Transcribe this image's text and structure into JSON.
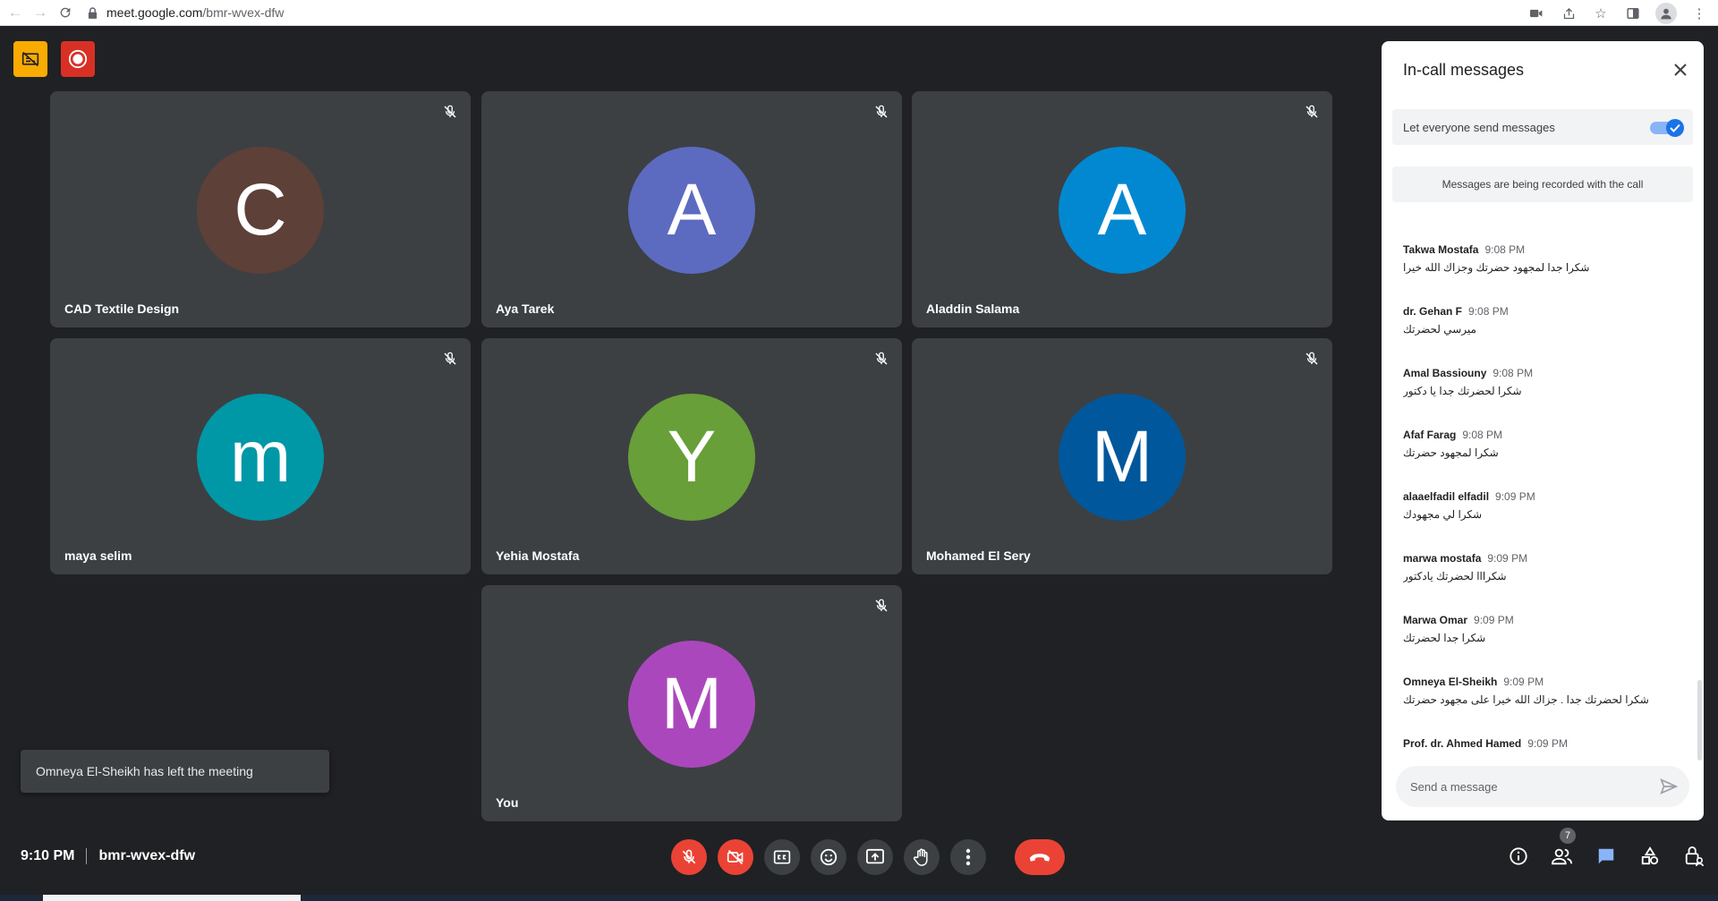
{
  "browser": {
    "url_host": "meet.google.com",
    "url_path": "/bmr-wvex-dfw"
  },
  "tiles": [
    {
      "name": "CAD Textile Design",
      "initial": "C",
      "color": "#5d4037"
    },
    {
      "name": "Aya Tarek",
      "initial": "A",
      "color": "#5c6bc0"
    },
    {
      "name": "Aladdin Salama",
      "initial": "A",
      "color": "#0288d1"
    },
    {
      "name": "maya selim",
      "initial": "m",
      "color": "#0097a7"
    },
    {
      "name": "Yehia Mostafa",
      "initial": "Y",
      "color": "#689f38"
    },
    {
      "name": "Mohamed El Sery",
      "initial": "M",
      "color": "#01579b"
    },
    {
      "name": "You",
      "initial": "M",
      "color": "#ab47bc"
    }
  ],
  "toast": {
    "text": "Omneya El-Sheikh has left the meeting"
  },
  "meeting": {
    "time": "9:10 PM",
    "code": "bmr-wvex-dfw",
    "participant_count": "7"
  },
  "panel": {
    "title": "In-call messages",
    "toggle_label": "Let everyone send messages",
    "toggle_on": true,
    "record_note": "Messages are being recorded with the call",
    "input_placeholder": "Send a message",
    "messages": [
      {
        "sender": "Takwa Mostafa",
        "time": "9:08 PM",
        "text": "شكرا جدا لمجهود حضرتك وجزاك الله خيرا"
      },
      {
        "sender": "dr. Gehan F",
        "time": "9:08 PM",
        "text": "ميرسي لحضرتك"
      },
      {
        "sender": "Amal Bassiouny",
        "time": "9:08 PM",
        "text": "شكرا لحضرتك جدا يا دكتور"
      },
      {
        "sender": "Afaf Farag",
        "time": "9:08 PM",
        "text": "شكرا لمجهود حضرتك"
      },
      {
        "sender": "alaaelfadil elfadil",
        "time": "9:09 PM",
        "text": "شكرا لي مجهودك"
      },
      {
        "sender": "marwa mostafa",
        "time": "9:09 PM",
        "text": "شكرااا لحضرتك يادكتور"
      },
      {
        "sender": "Marwa Omar",
        "time": "9:09 PM",
        "text": "شكرا جدا لحضرتك"
      },
      {
        "sender": "Omneya El-Sheikh",
        "time": "9:09 PM",
        "text": "شكرا لحضرتك جدا . جزاك الله خيرا على مجهود حضرتك"
      },
      {
        "sender": "Prof. dr. Ahmed Hamed",
        "time": "9:09 PM",
        "text": ""
      }
    ]
  },
  "colors": {
    "background": "#202124",
    "tile": "#3c4043",
    "danger": "#ea4335",
    "accent": "#1a73e8"
  }
}
